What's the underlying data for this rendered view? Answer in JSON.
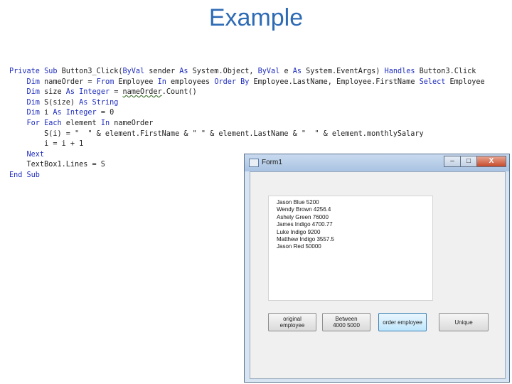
{
  "slide": {
    "title": "Example"
  },
  "code": {
    "lines": [
      [
        {
          "k": "kw",
          "t": "Private Sub "
        },
        {
          "k": "tx",
          "t": "Button3_Click("
        },
        {
          "k": "kw",
          "t": "ByVal "
        },
        {
          "k": "tx",
          "t": "sender "
        },
        {
          "k": "kw",
          "t": "As "
        },
        {
          "k": "tx",
          "t": "System.Object, "
        },
        {
          "k": "kw",
          "t": "ByVal "
        },
        {
          "k": "tx",
          "t": "e "
        },
        {
          "k": "kw",
          "t": "As "
        },
        {
          "k": "tx",
          "t": "System.EventArgs) "
        },
        {
          "k": "kw",
          "t": "Handles "
        },
        {
          "k": "tx",
          "t": "Button3.Click"
        }
      ],
      [
        {
          "k": "kw",
          "t": "    Dim "
        },
        {
          "k": "tx",
          "t": "nameOrder = "
        },
        {
          "k": "kw",
          "t": "From "
        },
        {
          "k": "tx",
          "t": "Employee "
        },
        {
          "k": "kw",
          "t": "In "
        },
        {
          "k": "tx",
          "t": "employees "
        },
        {
          "k": "kw",
          "t": "Order By "
        },
        {
          "k": "tx",
          "t": "Employee.LastName, Employee.FirstName "
        },
        {
          "k": "kw",
          "t": "Select "
        },
        {
          "k": "tx",
          "t": "Employee"
        }
      ],
      [
        {
          "k": "kw",
          "t": "    Dim "
        },
        {
          "k": "tx",
          "t": "size "
        },
        {
          "k": "kw",
          "t": "As Integer "
        },
        {
          "k": "tx",
          "t": "= "
        },
        {
          "k": "sq",
          "t": "nameOrder"
        },
        {
          "k": "tx",
          "t": ".Count()"
        }
      ],
      [
        {
          "k": "kw",
          "t": "    Dim "
        },
        {
          "k": "tx",
          "t": "S(size) "
        },
        {
          "k": "kw",
          "t": "As String"
        }
      ],
      [
        {
          "k": "kw",
          "t": "    Dim "
        },
        {
          "k": "tx",
          "t": "i "
        },
        {
          "k": "kw",
          "t": "As Integer "
        },
        {
          "k": "tx",
          "t": "= 0"
        }
      ],
      [
        {
          "k": "kw",
          "t": "    For Each "
        },
        {
          "k": "tx",
          "t": "element "
        },
        {
          "k": "kw",
          "t": "In "
        },
        {
          "k": "tx",
          "t": "nameOrder"
        }
      ],
      [
        {
          "k": "tx",
          "t": "        S(i) = \"  \" & element.FirstName & \" \" & element.LastName & \"  \" & element.monthlySalary"
        }
      ],
      [
        {
          "k": "tx",
          "t": "        i = i + 1"
        }
      ],
      [
        {
          "k": "kw",
          "t": "    Next"
        }
      ],
      [
        {
          "k": "tx",
          "t": "    TextBox1.Lines = S"
        }
      ],
      [
        {
          "k": "kw",
          "t": "End Sub"
        }
      ]
    ]
  },
  "form": {
    "title": "Form1",
    "controls": {
      "minimize": "–",
      "maximize": "□",
      "close": "X"
    },
    "textbox_lines": [
      "Jason Blue  5200",
      "Wendy Brown  4256.4",
      "Ashely Green  76000",
      "James Indigo  4700.77",
      "Luke Indigo  9200",
      "Matthew Indigo  3557.5",
      "Jason Red  50000"
    ],
    "buttons": [
      {
        "label": "original\nemployee"
      },
      {
        "label": "Between\n4000 5000"
      },
      {
        "label": "order employee"
      },
      {
        "label": "Unique"
      }
    ]
  }
}
